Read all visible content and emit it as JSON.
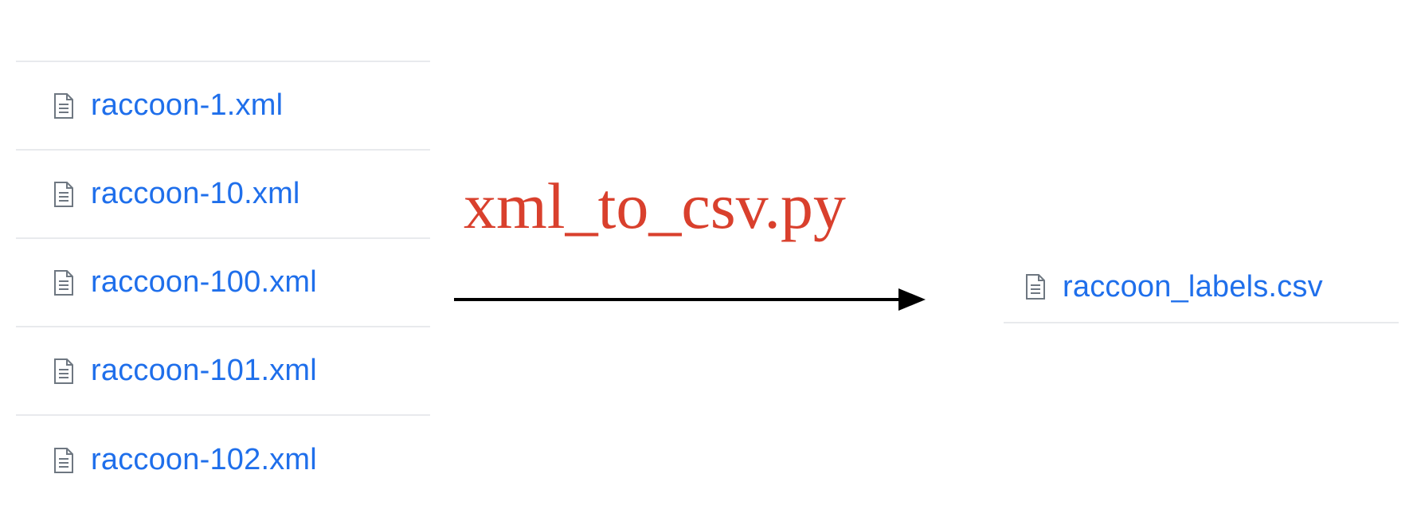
{
  "input_files": [
    {
      "name": "raccoon-1.xml",
      "icon": "file-icon"
    },
    {
      "name": "raccoon-10.xml",
      "icon": "file-icon"
    },
    {
      "name": "raccoon-100.xml",
      "icon": "file-icon"
    },
    {
      "name": "raccoon-101.xml",
      "icon": "file-icon"
    },
    {
      "name": "raccoon-102.xml",
      "icon": "file-icon"
    }
  ],
  "script": {
    "label": "xml_to_csv.py",
    "color": "#d9402d"
  },
  "output_file": {
    "name": "raccoon_labels.csv",
    "icon": "file-icon"
  },
  "colors": {
    "link": "#1f6feb",
    "icon": "#6e7781",
    "divider": "#e8eaed",
    "arrow": "#000000"
  }
}
